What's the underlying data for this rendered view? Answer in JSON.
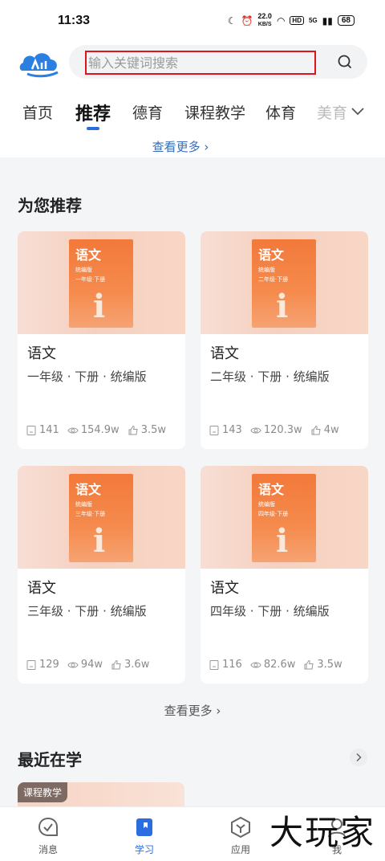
{
  "status_bar": {
    "time": "11:33",
    "speed_value": "22.0",
    "speed_unit": "KB/S",
    "hd": "HD",
    "net": "5G",
    "battery": "68"
  },
  "search": {
    "placeholder": "输入关键词搜索"
  },
  "tabs": [
    {
      "label": "首页",
      "active": false
    },
    {
      "label": "推荐",
      "active": true
    },
    {
      "label": "德育",
      "active": false
    },
    {
      "label": "课程教学",
      "active": false
    },
    {
      "label": "体育",
      "active": false
    },
    {
      "label": "美育",
      "active": false
    }
  ],
  "top_see_more": "查看更多 ›",
  "recommend": {
    "title": "为您推荐",
    "cards": [
      {
        "cover_title": "语文",
        "cover_edition": "统编版",
        "cover_grade": "一年级·下册",
        "name": "语文",
        "desc": "一年级 · 下册 · 统编版",
        "lessons": "141",
        "views": "154.9w",
        "likes": "3.5w"
      },
      {
        "cover_title": "语文",
        "cover_edition": "统编版",
        "cover_grade": "二年级·下册",
        "name": "语文",
        "desc": "二年级 · 下册 · 统编版",
        "lessons": "143",
        "views": "120.3w",
        "likes": "4w"
      },
      {
        "cover_title": "语文",
        "cover_edition": "统编版",
        "cover_grade": "三年级·下册",
        "name": "语文",
        "desc": "三年级 · 下册 · 统编版",
        "lessons": "129",
        "views": "94w",
        "likes": "3.6w"
      },
      {
        "cover_title": "语文",
        "cover_edition": "统编版",
        "cover_grade": "四年级·下册",
        "name": "语文",
        "desc": "四年级 · 下册 · 统编版",
        "lessons": "116",
        "views": "82.6w",
        "likes": "3.5w"
      }
    ],
    "see_more": "查看更多 ›"
  },
  "recent": {
    "title": "最近在学",
    "tag": "课程教学"
  },
  "nav": {
    "items": [
      {
        "label": "消息",
        "active": false
      },
      {
        "label": "学习",
        "active": true
      },
      {
        "label": "应用",
        "active": false
      },
      {
        "label": "我",
        "active": false
      }
    ]
  },
  "watermark": "大玩家",
  "colors": {
    "accent": "#2b6de0",
    "highlight_border": "#e0141e",
    "book_orange": "#f2793a"
  }
}
